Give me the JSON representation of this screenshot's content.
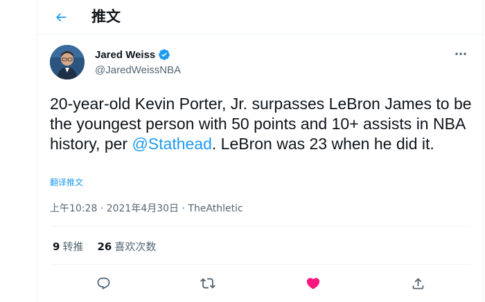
{
  "header": {
    "title": "推文",
    "back_icon": "arrow-left-icon"
  },
  "author": {
    "name": "Jared Weiss",
    "handle": "@JaredWeissNBA",
    "verified_icon": "verified-badge-icon"
  },
  "tweet": {
    "text_before": "20-year-old Kevin Porter, Jr. surpasses LeBron James to be the youngest person with 50 points and 10+ assists in NBA history, per ",
    "mention": "@Stathead",
    "text_after": ". LeBron was 23 when he did it.",
    "translate_label": "翻译推文",
    "timestamp": "上午10:28 · 2021年4月30日 · ",
    "source": "TheAthletic"
  },
  "stats": {
    "retweets_count": "9",
    "retweets_label": "转推",
    "likes_count": "26",
    "likes_label": "喜欢次数"
  },
  "colors": {
    "accent": "#1d9bf0",
    "like": "#f91880",
    "muted": "#536471",
    "border": "#eff3f4"
  },
  "actions": [
    "reply-icon",
    "retweet-icon",
    "like-icon",
    "share-icon"
  ]
}
